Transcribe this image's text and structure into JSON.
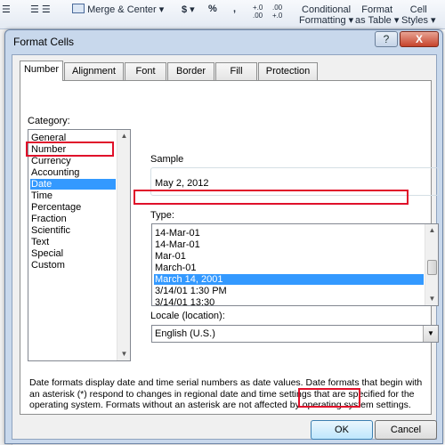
{
  "ribbon": {
    "merge_center": "Merge & Center",
    "currency_symbol": "$",
    "percent_symbol": "%",
    "comma_symbol": ",",
    "increase_decimal": "+.0 .00",
    "decrease_decimal": ".00 +.0",
    "conditional_formatting_1": "Conditional",
    "conditional_formatting_2": "Formatting",
    "format_table_1": "Format",
    "format_table_2": "as Table",
    "cell_styles_1": "Cell",
    "cell_styles_2": "Styles"
  },
  "dialog": {
    "title": "Format Cells",
    "help": "?",
    "close": "X",
    "tabs": [
      "Number",
      "Alignment",
      "Font",
      "Border",
      "Fill",
      "Protection"
    ],
    "category_label": "Category:",
    "categories": [
      "General",
      "Number",
      "Currency",
      "Accounting",
      "Date",
      "Time",
      "Percentage",
      "Fraction",
      "Scientific",
      "Text",
      "Special",
      "Custom"
    ],
    "selected_category": "Date",
    "sample_label": "Sample",
    "sample_value": "May 2, 2012",
    "type_label": "Type:",
    "types": [
      "14-Mar-01",
      "14-Mar-01",
      "Mar-01",
      "March-01",
      "March 14, 2001",
      "3/14/01 1:30 PM",
      "3/14/01 13:30"
    ],
    "selected_type": "March 14, 2001",
    "locale_label": "Locale (location):",
    "locale_value": "English (U.S.)",
    "description": "Date formats display date and time serial numbers as date values.  Date formats that begin with an asterisk (*) respond to changes in regional date and time settings that are specified for the operating system. Formats without an asterisk are not affected by operating system settings.",
    "ok_label": "OK",
    "cancel_label": "Cancel"
  },
  "colors": {
    "highlight": "#3399ff",
    "annotation_red": "#e0102a",
    "dialog_frame": "#c8d8ec"
  }
}
